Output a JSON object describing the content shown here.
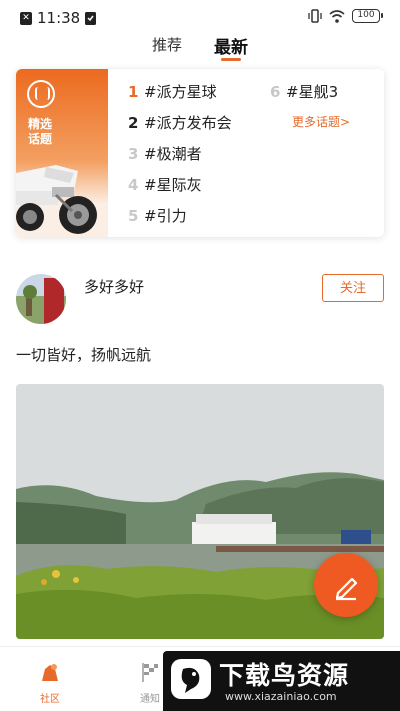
{
  "status_bar": {
    "time": "11:38",
    "battery": "100"
  },
  "tabs": [
    {
      "label": "推荐"
    },
    {
      "label": "最新"
    }
  ],
  "banner": {
    "line1": "精选",
    "line2": "话题"
  },
  "topics": [
    {
      "rank": "1",
      "label": "#派方星球"
    },
    {
      "rank": "2",
      "label": "#派方发布会"
    },
    {
      "rank": "3",
      "label": "#极潮者"
    },
    {
      "rank": "4",
      "label": "#星际灰"
    },
    {
      "rank": "5",
      "label": "#引力"
    },
    {
      "rank": "6",
      "label": "#星舰3"
    }
  ],
  "more_topics": "更多话题>",
  "post": {
    "username": "多好多好",
    "follow_label": "关注",
    "text": "一切皆好，扬帆远航"
  },
  "bottom_nav": [
    {
      "label": "社区"
    },
    {
      "label": "通知"
    }
  ],
  "watermark": {
    "title": "下载鸟资源",
    "url": "www.xiazainiao.com"
  },
  "colors": {
    "accent": "#e86a2a",
    "fab": "#ee5a22"
  }
}
